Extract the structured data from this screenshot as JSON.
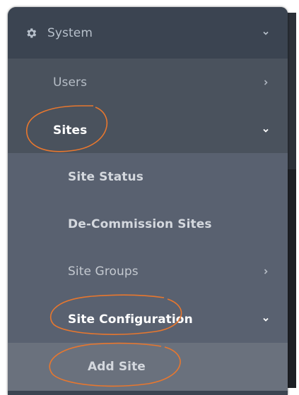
{
  "menu": {
    "system": {
      "label": "System",
      "icon": "gear-icon",
      "expanded": true
    },
    "items": [
      {
        "label": "Users",
        "icon": "chevron-right-icon"
      },
      {
        "label": "Sites",
        "icon": "chevron-down-icon",
        "expanded": true
      }
    ],
    "sites_children": [
      {
        "label": "Site Status"
      },
      {
        "label": "De-Commission Sites"
      },
      {
        "label": "Site Groups",
        "icon": "chevron-right-icon"
      },
      {
        "label": "Site Configuration",
        "icon": "chevron-down-icon",
        "expanded": true
      }
    ],
    "config_children": [
      {
        "label": "Add Site"
      }
    ]
  },
  "colors": {
    "annotation": "#e8772e",
    "menu_bg": "#3b4451",
    "submenu_bg": "#596170",
    "active_bg": "#6a717d"
  }
}
